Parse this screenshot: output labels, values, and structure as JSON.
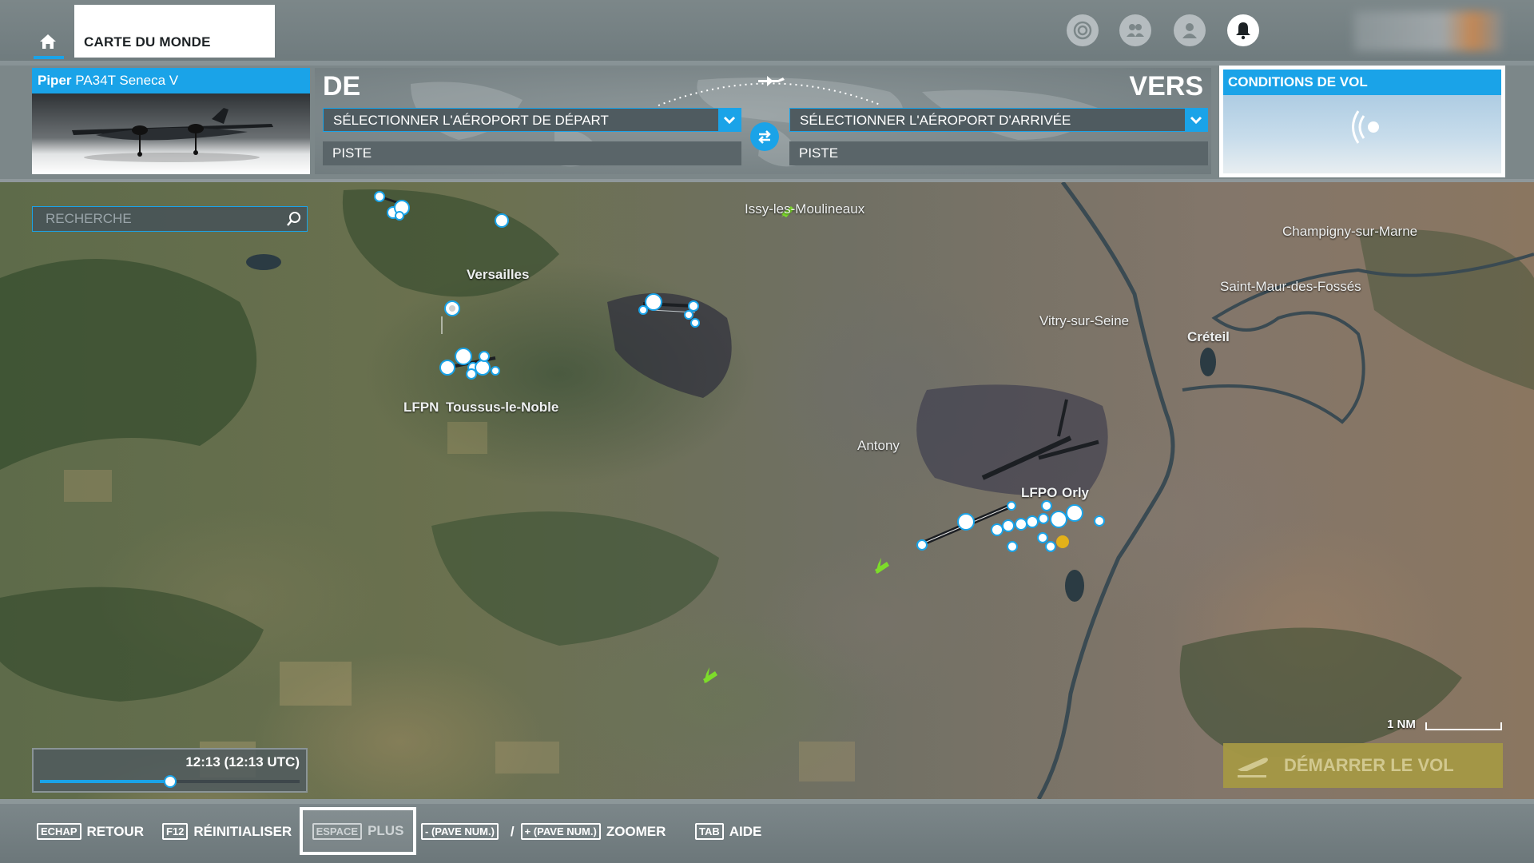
{
  "topbar": {
    "world_tab": "CARTE DU MONDE",
    "icons": [
      "achievements-icon",
      "multiplayer-icon",
      "profile-icon",
      "notifications-icon"
    ]
  },
  "aircraft": {
    "make": "Piper",
    "model": "PA34T Seneca V"
  },
  "route": {
    "from_label": "DE",
    "to_label": "VERS",
    "departure_select": "SÉLECTIONNER L'AÉROPORT DE DÉPART",
    "arrival_select": "SÉLECTIONNER L'AÉROPORT D'ARRIVÉE",
    "departure_runway": "PISTE",
    "arrival_runway": "PISTE"
  },
  "conditions": {
    "title": "CONDITIONS DE VOL"
  },
  "search": {
    "placeholder": "RECHERCHE"
  },
  "map": {
    "labels": {
      "issy": "Issy-les-Moulineaux",
      "champigny": "Champigny-sur-Marne",
      "versailles": "Versailles",
      "saint_maur": "Saint-Maur-des-Fossés",
      "vitry": "Vitry-sur-Seine",
      "creteil": "Créteil",
      "lfpn": "LFPN",
      "toussus": "Toussus-le-Noble",
      "antony": "Antony",
      "lfpo": "LFPO",
      "orly": "Orly"
    },
    "scale_label": "1 NM"
  },
  "time": {
    "display": "12:13 (12:13 UTC)",
    "progress": 0.5
  },
  "start_button": "DÉMARRER LE VOL",
  "footer": {
    "esc_key": "ECHAP",
    "esc_label": "RETOUR",
    "f12_key": "F12",
    "f12_label": "RÉINITIALISER",
    "space_key": "ESPACE",
    "space_label": "PLUS",
    "minus_key": "- (PAVE NUM.)",
    "slash": "/",
    "plus_key": "+ (PAVE NUM.)",
    "zoom_label": "ZOOMER",
    "tab_key": "TAB",
    "help_label": "AIDE"
  },
  "colors": {
    "accent": "#1aa3e8",
    "start_button": "#a59845",
    "airport_poi": "#ffffff",
    "traffic_plane": "#7ddc2a"
  }
}
